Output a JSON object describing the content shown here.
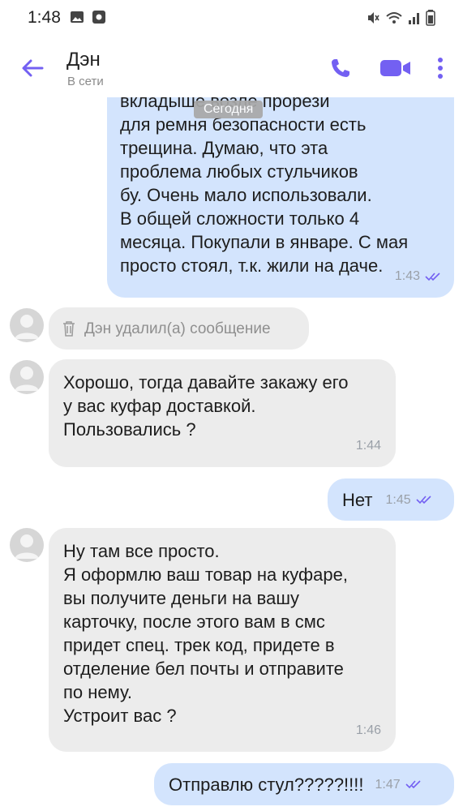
{
  "status_bar": {
    "time": "1:48"
  },
  "header": {
    "name": "Дэн",
    "status": "В сети"
  },
  "chat": {
    "date_separator": "Сегодня",
    "messages": [
      {
        "text": "вкладыше возле прорези\nдля ремня безопасности есть\nтрещина. Думаю, что эта\nпроблема любых стульчиков\nбу. Очень мало использовали.\nВ общей сложности только 4\nмесяца. Покупали в январе. С мая\nпросто стоял, т.к. жили на даче.",
        "time": "1:43"
      },
      {
        "text": "Дэн удалил(а) сообщение"
      },
      {
        "text": "Хорошо, тогда давайте закажу его\nу вас куфар доставкой.\nПользовались ?",
        "time": "1:44"
      },
      {
        "text": "Нет",
        "time": "1:45"
      },
      {
        "text": "Ну там все просто.\nЯ оформлю ваш товар на куфаре,\nвы получите деньги на вашу\nкарточку, после этого вам в смс\nпридет спец. трек код, придете в\nотделение бел почты и отправите\nпо нему.\nУстроит вас ?",
        "time": "1:46"
      },
      {
        "text": "Отправлю стул?????!!!!",
        "time": "1:47"
      }
    ]
  },
  "colors": {
    "accent": "#7360f2",
    "outgoing_bubble": "#d3e4fd",
    "incoming_bubble": "#ececec"
  }
}
